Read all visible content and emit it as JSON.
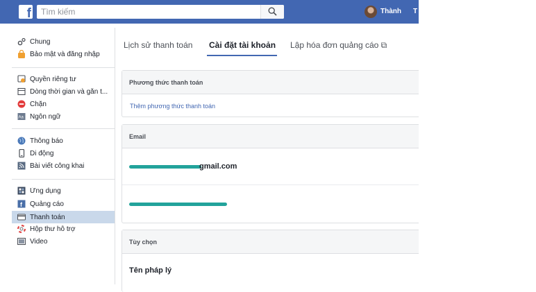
{
  "topbar": {
    "logo": "f",
    "search_placeholder": "Tìm kiếm",
    "user_name": "Thành",
    "extra": "T"
  },
  "sidebar": {
    "groups": [
      [
        {
          "label": "Chung",
          "icon": "gear-icon"
        },
        {
          "label": "Bảo mật và đăng nhập",
          "icon": "lock-icon"
        }
      ],
      [
        {
          "label": "Quyền riêng tư",
          "icon": "privacy-icon"
        },
        {
          "label": "Dòng thời gian và gắn t...",
          "icon": "timeline-icon"
        },
        {
          "label": "Chặn",
          "icon": "block-icon"
        },
        {
          "label": "Ngôn ngữ",
          "icon": "language-icon"
        }
      ],
      [
        {
          "label": "Thông báo",
          "icon": "globe-icon"
        },
        {
          "label": "Di động",
          "icon": "mobile-icon"
        },
        {
          "label": "Bài viết công khai",
          "icon": "rss-icon"
        }
      ],
      [
        {
          "label": "Ứng dụng",
          "icon": "apps-icon"
        },
        {
          "label": "Quảng cáo",
          "icon": "ads-icon"
        },
        {
          "label": "Thanh toán",
          "icon": "payment-icon",
          "active": true
        },
        {
          "label": "Hộp thư hỗ trợ",
          "icon": "support-icon"
        },
        {
          "label": "Video",
          "icon": "video-icon"
        }
      ]
    ]
  },
  "tabs": [
    {
      "label": "Lịch sử thanh toán"
    },
    {
      "label": "Cài đặt tài khoản",
      "active": true
    },
    {
      "label": "Lập hóa đơn quảng cáo ⧉"
    }
  ],
  "payment_methods": {
    "header": "Phương thức thanh toán",
    "add_link": "Thêm phương thức thanh toán"
  },
  "email_section": {
    "header": "Email",
    "primary_suffix": "gmail.com"
  },
  "options_section": {
    "header": "Tùy chọn",
    "legal_name_label": "Tên pháp lý"
  },
  "colors": {
    "brand": "#4267b2",
    "active_item": "#c9d8ea",
    "redaction": "#22a39b"
  }
}
